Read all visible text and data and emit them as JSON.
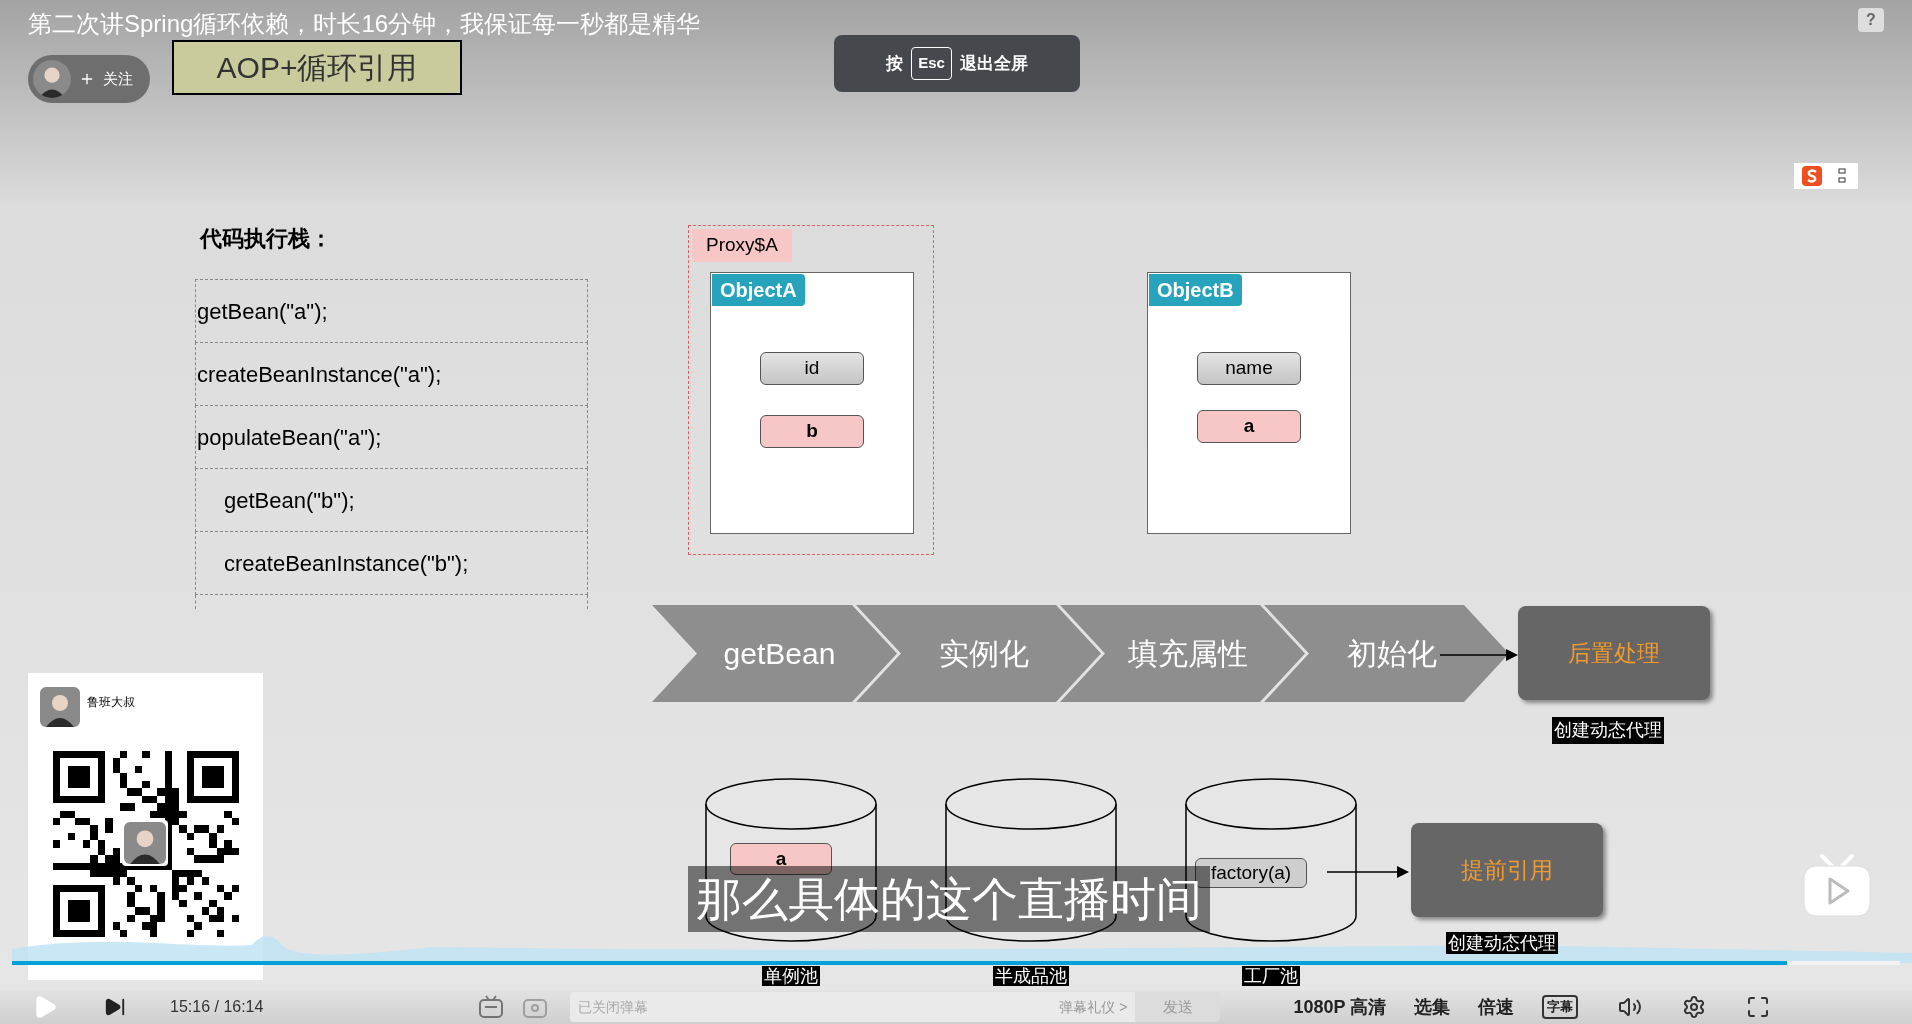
{
  "video_title": "第二次讲Spring循环依赖，时长16分钟，我保证每一秒都是精华",
  "uploader": {
    "follow_label": "关注"
  },
  "esc_hint": {
    "prefix": "按",
    "key": "Esc",
    "suffix": "退出全屏"
  },
  "help_glyph": "?",
  "slide": {
    "heading": "AOP+循环引用",
    "stack_title": "代码执行栈：",
    "stack": [
      {
        "text": "getBean(\"a\");",
        "indented": false
      },
      {
        "text": "createBeanInstance(\"a\");",
        "indented": false
      },
      {
        "text": "populateBean(\"a\");",
        "indented": false
      },
      {
        "text": "getBean(\"b\");",
        "indented": true
      },
      {
        "text": "createBeanInstance(\"b\");",
        "indented": true
      }
    ],
    "proxy_label": "Proxy$A",
    "objects": [
      {
        "title": "ObjectA",
        "fields": [
          {
            "label": "id",
            "kind": "plain"
          },
          {
            "label": "b",
            "kind": "reference"
          }
        ]
      },
      {
        "title": "ObjectB",
        "fields": [
          {
            "label": "name",
            "kind": "plain"
          },
          {
            "label": "a",
            "kind": "reference"
          }
        ]
      }
    ],
    "pipeline": [
      "getBean",
      "实例化",
      "填充属性",
      "初始化"
    ],
    "post_process": {
      "label": "后置处理",
      "caption": "创建动态代理"
    },
    "pools": [
      {
        "label": "单例池",
        "entry": {
          "label": "a",
          "kind": "reference"
        }
      },
      {
        "label": "半成品池"
      },
      {
        "label": "工厂池",
        "entry": {
          "label": "factory(a)",
          "kind": "factory"
        }
      }
    ],
    "early_reference": {
      "label": "提前引用",
      "caption": "创建动态代理"
    }
  },
  "subtitle": "那么具体的这个直播时间",
  "qr_card": {
    "name": "鲁班大叔"
  },
  "player": {
    "progress": {
      "level": 0.94
    },
    "time": "15:16 / 16:14",
    "danmaku_on": false,
    "danmaku_placeholder": "已关闭弹幕",
    "etiquette": "弹幕礼仪 >",
    "send": "发送",
    "quality": "1080P 高清",
    "episodes": "选集",
    "speed": "倍速",
    "subtitles": "字幕"
  }
}
